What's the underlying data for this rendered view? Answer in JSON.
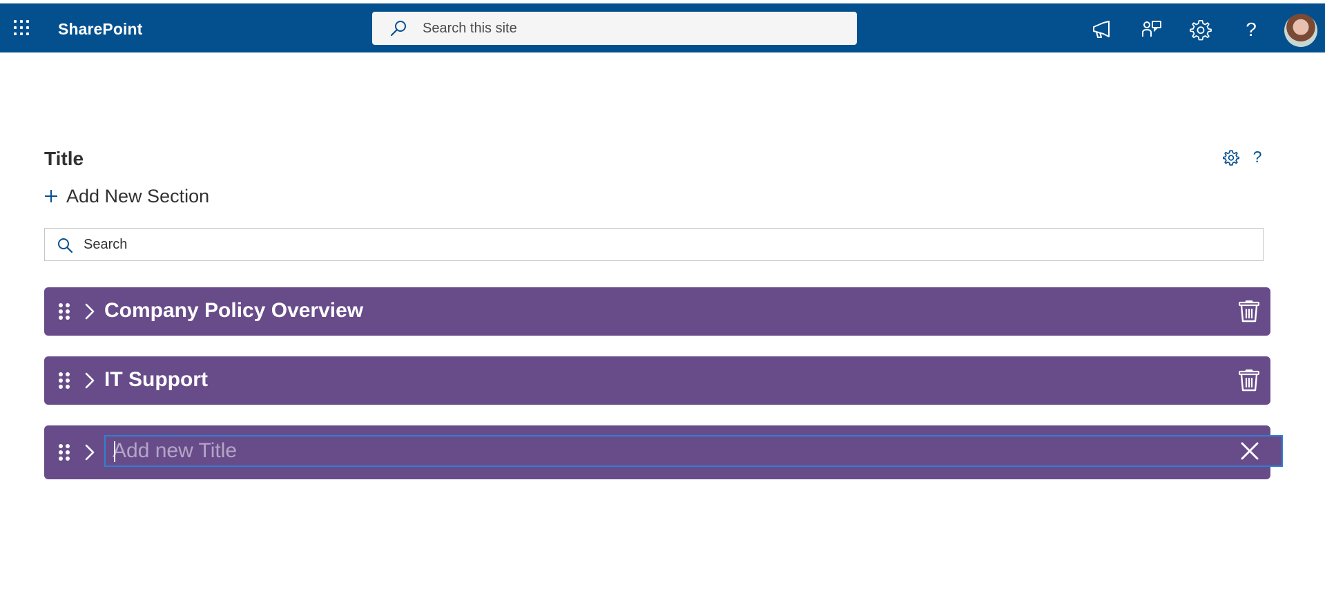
{
  "suitebar": {
    "app_name": "SharePoint",
    "search_placeholder": "Search this site",
    "icons": [
      "app-launcher-icon",
      "megaphone-icon",
      "feedback-icon",
      "settings-icon",
      "help-icon"
    ],
    "help_glyph": "?",
    "colors": {
      "background": "#04508f",
      "text": "#ffffff"
    }
  },
  "webpart": {
    "title": "Title",
    "help_glyph": "?",
    "add_section_label": "Add New Section",
    "search_placeholder": "Search",
    "accent": "#684c8a"
  },
  "sections": [
    {
      "title": "Company Policy Overview",
      "editing": false
    },
    {
      "title": "IT Support",
      "editing": false
    },
    {
      "title": "",
      "editing": true,
      "placeholder": "Add new Title"
    }
  ]
}
